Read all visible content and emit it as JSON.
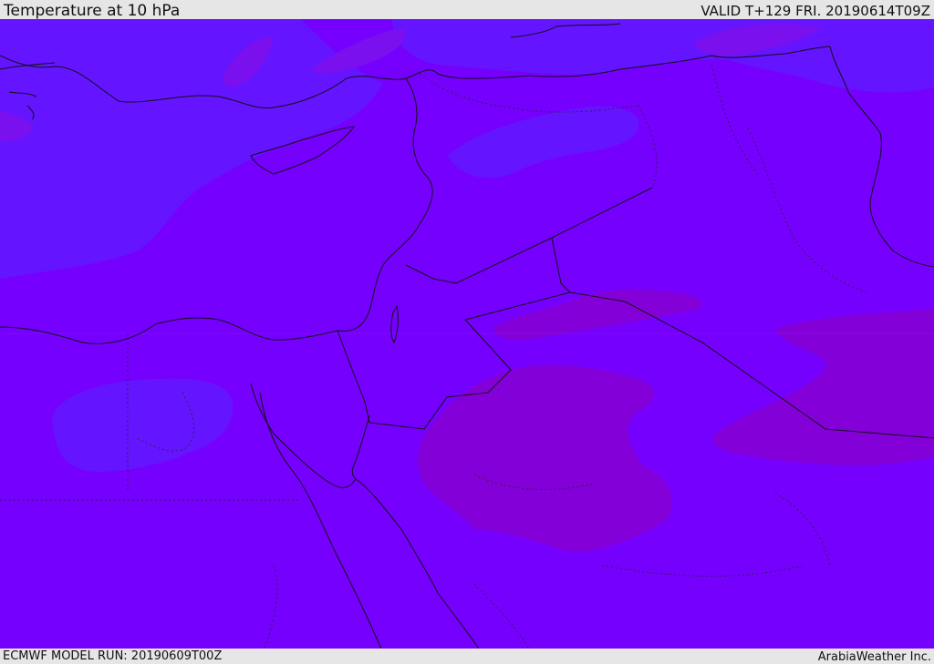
{
  "header": {
    "title": "Temperature at 10 hPa",
    "valid": "VALID T+129 FRI. 20190614T09Z"
  },
  "footer": {
    "model_run": "ECMWF MODEL RUN: 20190609T00Z",
    "credit": "ArabiaWeather Inc."
  },
  "colors": {
    "field_main": "#7600fd",
    "field_cool": "#6414ff",
    "field_warm": "#8400d8",
    "coastline": "#111111",
    "borders": "#222222"
  }
}
